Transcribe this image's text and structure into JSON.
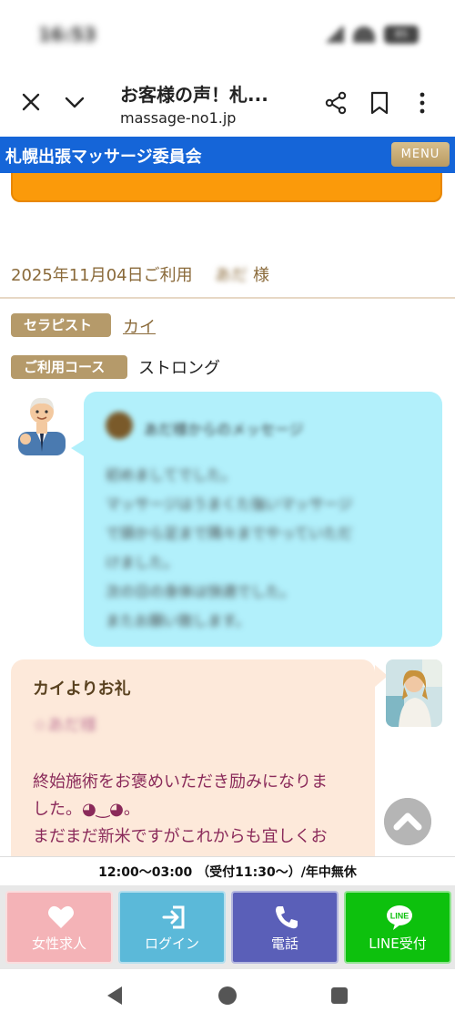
{
  "status_bar": {
    "time": "16:53",
    "battery": "85"
  },
  "browser": {
    "title": "お客様の声！札...",
    "url": "massage-no1.jp"
  },
  "site": {
    "name": "札幌出張マッサージ委員会",
    "menu_label": "MENU"
  },
  "review": {
    "date": "2025年11月04日ご利用",
    "customer_name": "あだ",
    "honorific": "様",
    "therapist_tag": "セラピスト",
    "therapist_name": "カイ",
    "course_tag": "ご利用コース",
    "course_name": "ストロング"
  },
  "customer_message": {
    "header": "あだ様からのメッセージ",
    "lines": [
      "初めましてでした。",
      "マッサージはうまくた強いマッサージ",
      "で頭から足まで隅々までやっていただ",
      "けました。",
      "次の日の身体は快適でした。",
      "またお願い致します。"
    ]
  },
  "therapist_reply": {
    "title": "カイよりお礼",
    "to": "☆あだ様",
    "lines": [
      "終始施術をお褒めいただき励みになりま",
      "した。◕‿◕。",
      "まだまだ新米ですがこれからも宜しくお"
    ]
  },
  "footer": {
    "hours": "12:00〜03:00 （受付11:30〜）/年中無休",
    "buttons": [
      {
        "label": "女性求人",
        "icon": "heart-icon",
        "color": "#f4b3b7"
      },
      {
        "label": "ログイン",
        "icon": "login-icon",
        "color": "#5bb9d9"
      },
      {
        "label": "電話",
        "icon": "phone-icon",
        "color": "#5a5fb8"
      },
      {
        "label": "LINE受付",
        "icon": "line-icon",
        "color": "#0dc10d"
      }
    ]
  },
  "colors": {
    "header_blue": "#1565d8",
    "accent_gold": "#b59a6a",
    "message_bubble": "#b2f0fb",
    "reply_bubble": "#fde9da"
  }
}
